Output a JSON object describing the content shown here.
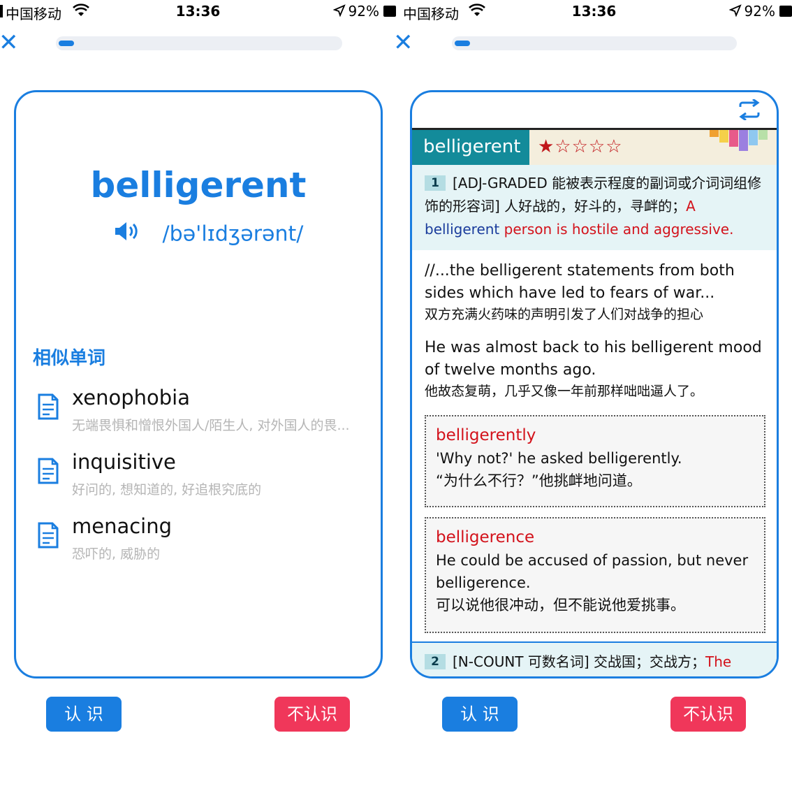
{
  "screens": [
    {
      "status": {
        "carrier": "中国移动",
        "time": "13:36",
        "battery": "92%"
      },
      "progress_fraction": 0.06,
      "word": "belligerent",
      "pronunciation": "/bə'lɪdʒərənt/",
      "similar_title": "相似单词",
      "similar_words": [
        {
          "word": "xenophobia",
          "def": "无端畏惧和憎恨外国人/陌生人, 对外国人的畏..."
        },
        {
          "word": "inquisitive",
          "def": "好问的, 想知道的, 好追根究底的"
        },
        {
          "word": "menacing",
          "def": "恐吓的, 威胁的"
        }
      ],
      "buttons": {
        "know": "认 识",
        "unknown": "不认识"
      }
    },
    {
      "status": {
        "carrier": "中国移动",
        "time": "13:36",
        "battery": "92%"
      },
      "progress_fraction": 0.06,
      "dict_word": "belligerent",
      "stars": "★☆☆☆☆",
      "sense1": {
        "num": "1",
        "text": "[ADJ-GRADED 能被表示程度的副词或介词词组修饰的形容词] 人好战的，好斗的，寻衅的；",
        "def_a": "A",
        "def_word": "belligerent",
        "def_rest": "person is hostile and aggressive."
      },
      "examples": [
        {
          "en": "//...the belligerent statements from both sides which have led to fears of war...",
          "zh": "双方充满火药味的声明引发了人们对战争的担心"
        },
        {
          "en": "He was almost back to his belligerent mood of twelve months ago.",
          "zh": "他故态复萌，几乎又像一年前那样咄咄逼人了。"
        }
      ],
      "derived": [
        {
          "word": "belligerently",
          "en": "'Why not?' he asked belligerently.",
          "zh": "“为什么不行？”他挑衅地问道。"
        },
        {
          "word": "belligerence",
          "en": "He could be accused of passion, but never belligerence.",
          "zh": "可以说他很冲动，但不能说他爱挑事。"
        }
      ],
      "sense2": {
        "num": "2",
        "text": "[N-COUNT 可数名词] 交战国；交战方；",
        "tail": "The"
      },
      "buttons": {
        "know": "认 识",
        "unknown": "不认识"
      }
    }
  ],
  "colors": {
    "accent": "#1a7ee0",
    "danger": "#f0375a",
    "dict_header": "#138b9a",
    "red_text": "#d3121b"
  }
}
